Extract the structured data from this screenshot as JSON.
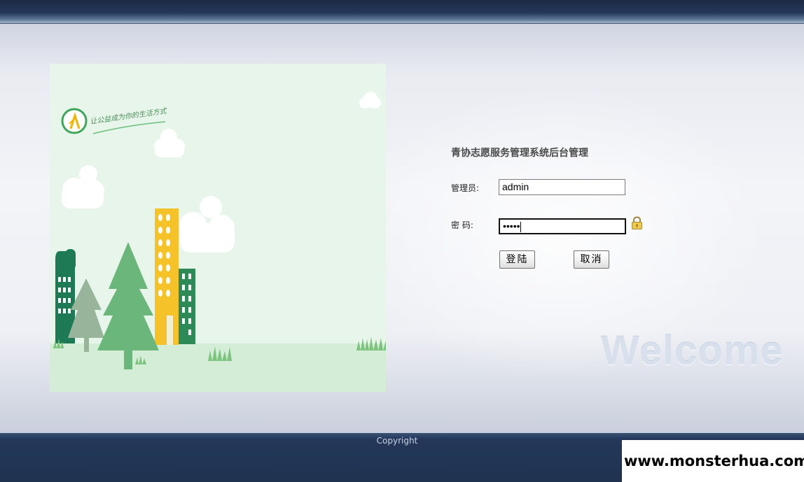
{
  "login": {
    "title": "青协志愿服务管理系统后台管理",
    "admin_label": "管理员:",
    "admin_value": "admin",
    "password_label": "密 码:",
    "password_value": "•••••",
    "login_button": "登陆",
    "cancel_button": "取消"
  },
  "illustration": {
    "slogan": "让公益成为你的生活方式",
    "icons": [
      "logo-badge-icon",
      "cloud-icon",
      "tree-icon",
      "building-icon",
      "grass-icon"
    ]
  },
  "decor": {
    "welcome": "Welcome"
  },
  "footer": {
    "copyright": "Copyright"
  },
  "watermark": {
    "text": "www.monsterhua.com"
  },
  "colors": {
    "header_bg": "#1b2a44",
    "footer_bg": "#1f3350",
    "illustration_bg": "#e7f5ea",
    "tree_green": "#6bb77b",
    "building_yellow": "#f5c22a",
    "building_dark_green": "#1e7a55"
  }
}
